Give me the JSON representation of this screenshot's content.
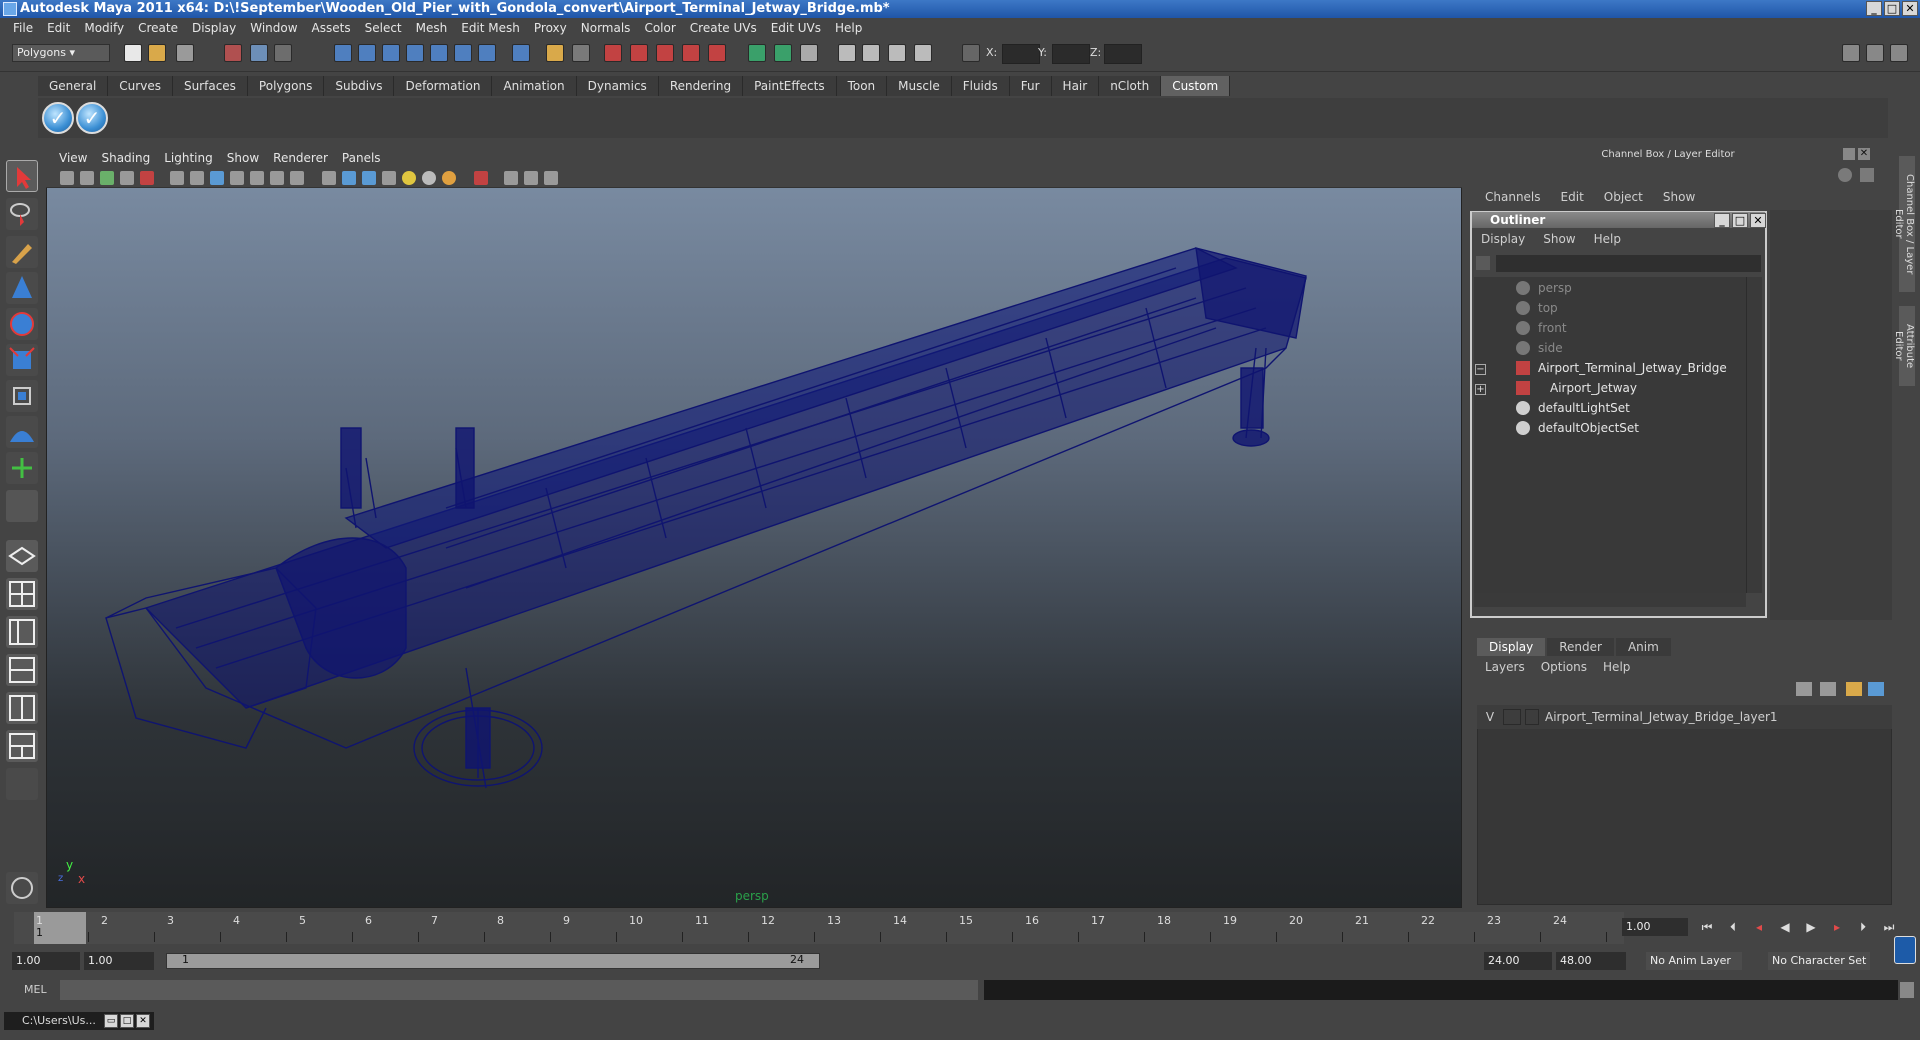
{
  "window": {
    "title": "Autodesk Maya 2011 x64: D:\\!September\\Wooden_Old_Pier_with_Gondola_convert\\Airport_Terminal_Jetway_Bridge.mb*"
  },
  "menubar": [
    "File",
    "Edit",
    "Modify",
    "Create",
    "Display",
    "Window",
    "Assets",
    "Select",
    "Mesh",
    "Edit Mesh",
    "Proxy",
    "Normals",
    "Color",
    "Create UVs",
    "Edit UVs",
    "Help"
  ],
  "toolbar": {
    "mode_select": "Polygons",
    "x_label": "X:",
    "y_label": "Y:",
    "z_label": "Z:"
  },
  "shelf_tabs": [
    "General",
    "Curves",
    "Surfaces",
    "Polygons",
    "Subdivs",
    "Deformation",
    "Animation",
    "Dynamics",
    "Rendering",
    "PaintEffects",
    "Toon",
    "Muscle",
    "Fluids",
    "Fur",
    "Hair",
    "nCloth",
    "Custom"
  ],
  "shelf_active": "Custom",
  "viewport": {
    "menu": [
      "View",
      "Shading",
      "Lighting",
      "Show",
      "Renderer",
      "Panels"
    ],
    "camera_label": "persp",
    "axis": {
      "y": "y",
      "x": "x",
      "z": "z"
    },
    "wire_color": "#0f1470"
  },
  "channel_box": {
    "title": "Channel Box / Layer Editor",
    "menu": [
      "Channels",
      "Edit",
      "Object",
      "Show"
    ]
  },
  "outliner": {
    "title": "Outliner",
    "menu": [
      "Display",
      "Show",
      "Help"
    ],
    "items": [
      {
        "label": "persp",
        "dim": true
      },
      {
        "label": "top",
        "dim": true
      },
      {
        "label": "front",
        "dim": true
      },
      {
        "label": "side",
        "dim": true
      },
      {
        "label": "Airport_Terminal_Jetway_Bridge",
        "dim": false
      },
      {
        "label": "Airport_Jetway",
        "dim": false
      },
      {
        "label": "defaultLightSet",
        "dim": false
      },
      {
        "label": "defaultObjectSet",
        "dim": false
      }
    ]
  },
  "layer_editor": {
    "tabs": [
      "Display",
      "Render",
      "Anim"
    ],
    "active_tab": "Display",
    "menu": [
      "Layers",
      "Options",
      "Help"
    ],
    "layers": [
      {
        "visible": "V",
        "name": "Airport_Terminal_Jetway_Bridge_layer1"
      }
    ]
  },
  "side_tabs": [
    "Channel Box / Layer Editor",
    "Attribute Editor"
  ],
  "timeline": {
    "ticks": [
      "1",
      "2",
      "3",
      "4",
      "5",
      "6",
      "7",
      "8",
      "9",
      "10",
      "11",
      "12",
      "13",
      "14",
      "15",
      "16",
      "17",
      "18",
      "19",
      "20",
      "21",
      "22",
      "23",
      "24"
    ],
    "current_frame_marker": "1",
    "current_frame": "1.00"
  },
  "range": {
    "start_time": "1.00",
    "playback_start": "1.00",
    "slider_start": "1",
    "slider_end": "24",
    "playback_end": "24.00",
    "end_time": "48.00",
    "anim_layer": "No Anim Layer",
    "character_set": "No Character Set"
  },
  "mel": {
    "label": "MEL"
  },
  "taskbar": {
    "item": "C:\\Users\\Us..."
  }
}
